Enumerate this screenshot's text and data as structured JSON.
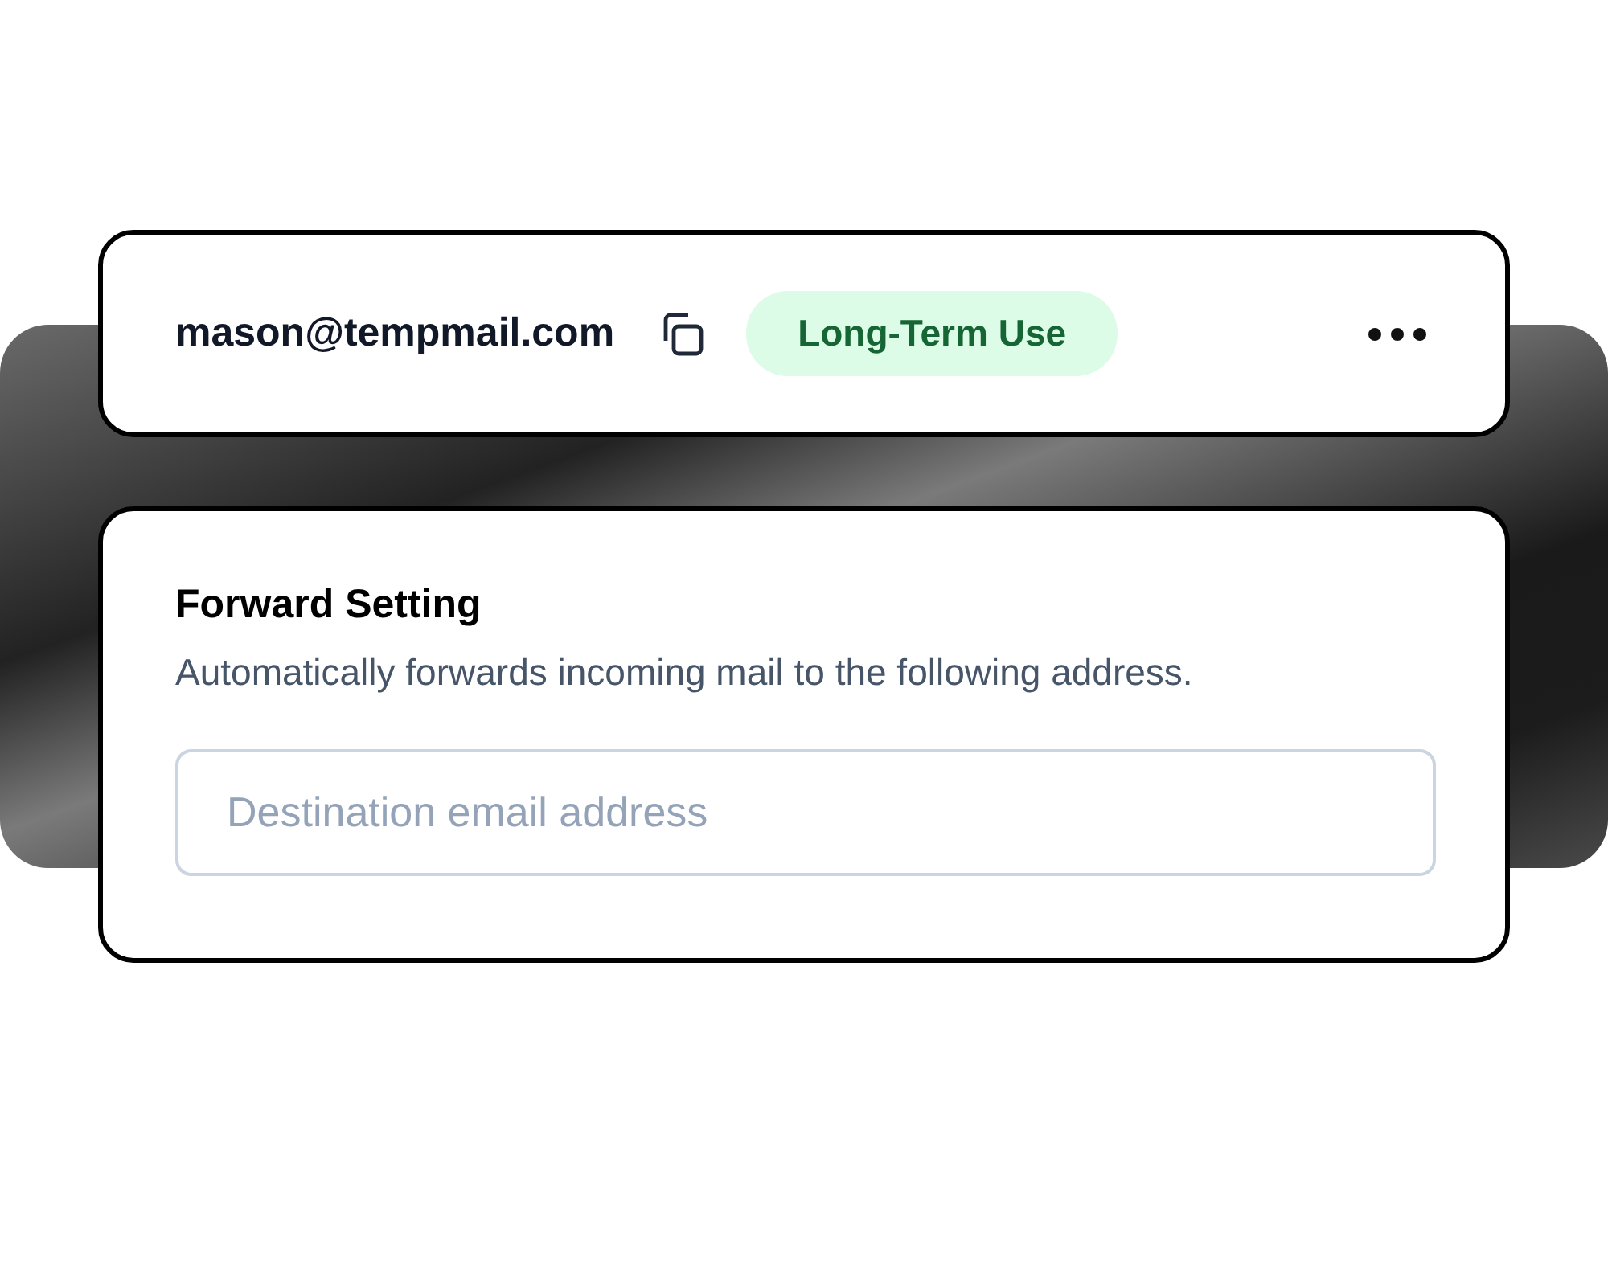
{
  "account": {
    "email": "mason@tempmail.com",
    "tag": {
      "label": "Long-Term Use"
    }
  },
  "forward": {
    "title": "Forward Setting",
    "description": "Automatically forwards incoming mail to the following address.",
    "destination": {
      "placeholder": "Destination email address"
    }
  }
}
